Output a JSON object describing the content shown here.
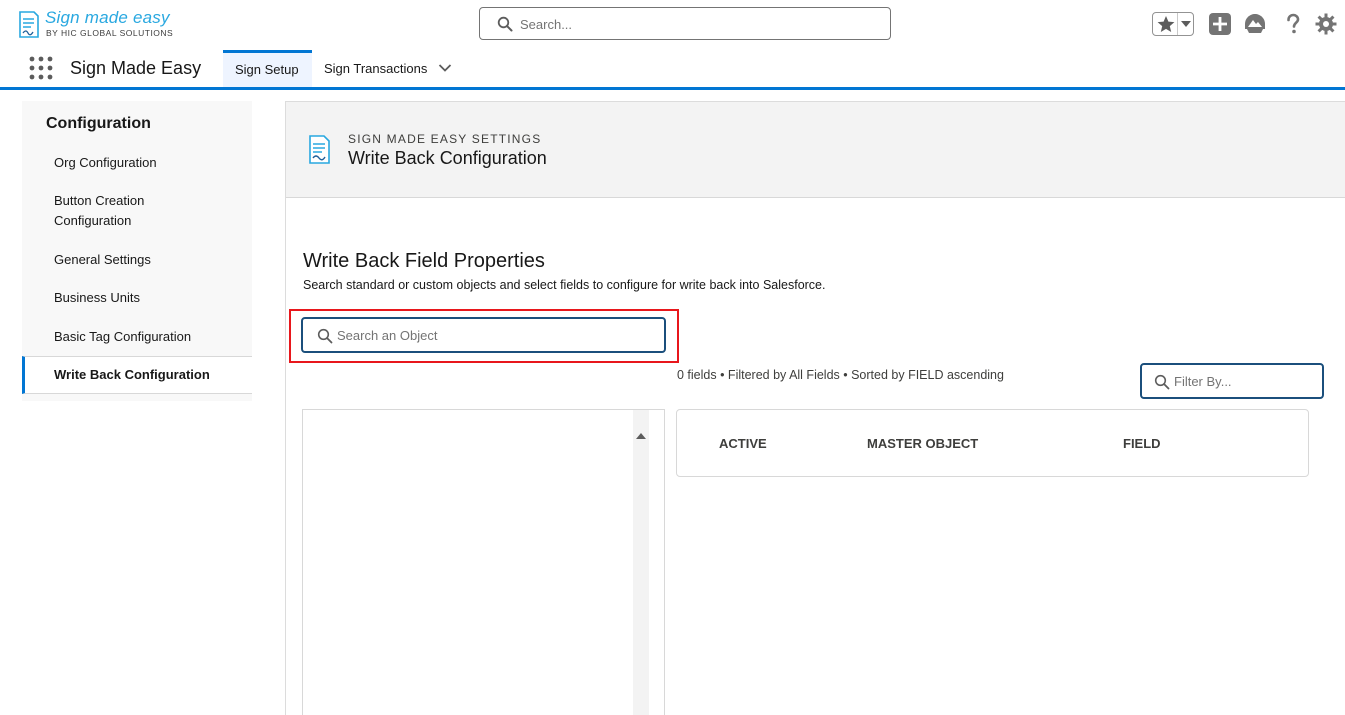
{
  "header": {
    "logo_title": "Sign made easy",
    "logo_subtitle": "BY HIC GLOBAL SOLUTIONS",
    "search_placeholder": "Search..."
  },
  "app_nav": {
    "app_name": "Sign Made Easy",
    "tabs": [
      {
        "label": "Sign Setup",
        "active": true
      },
      {
        "label": "Sign Transactions",
        "active": false
      }
    ]
  },
  "sidebar": {
    "title": "Configuration",
    "items": [
      {
        "label": "Org Configuration"
      },
      {
        "label": "Button Creation Configuration"
      },
      {
        "label": "General Settings"
      },
      {
        "label": "Business Units"
      },
      {
        "label": "Basic Tag Configuration"
      },
      {
        "label": "Write Back Configuration",
        "active": true
      }
    ]
  },
  "page_header": {
    "eyebrow": "SIGN MADE EASY SETTINGS",
    "title": "Write Back Configuration"
  },
  "section": {
    "title": "Write Back Field Properties",
    "description": "Search standard or custom objects and select fields to configure for write back into Salesforce.",
    "object_search_placeholder": "Search an Object",
    "filter_placeholder": "Filter By...",
    "list_meta": "0 fields • Filtered by All Fields • Sorted by FIELD ascending"
  },
  "table": {
    "columns": [
      "ACTIVE",
      "MASTER OBJECT",
      "FIELD"
    ]
  },
  "colors": {
    "brand_blue": "#0176d3",
    "highlight_red": "#e8171c",
    "input_border": "#1b4f7c"
  }
}
